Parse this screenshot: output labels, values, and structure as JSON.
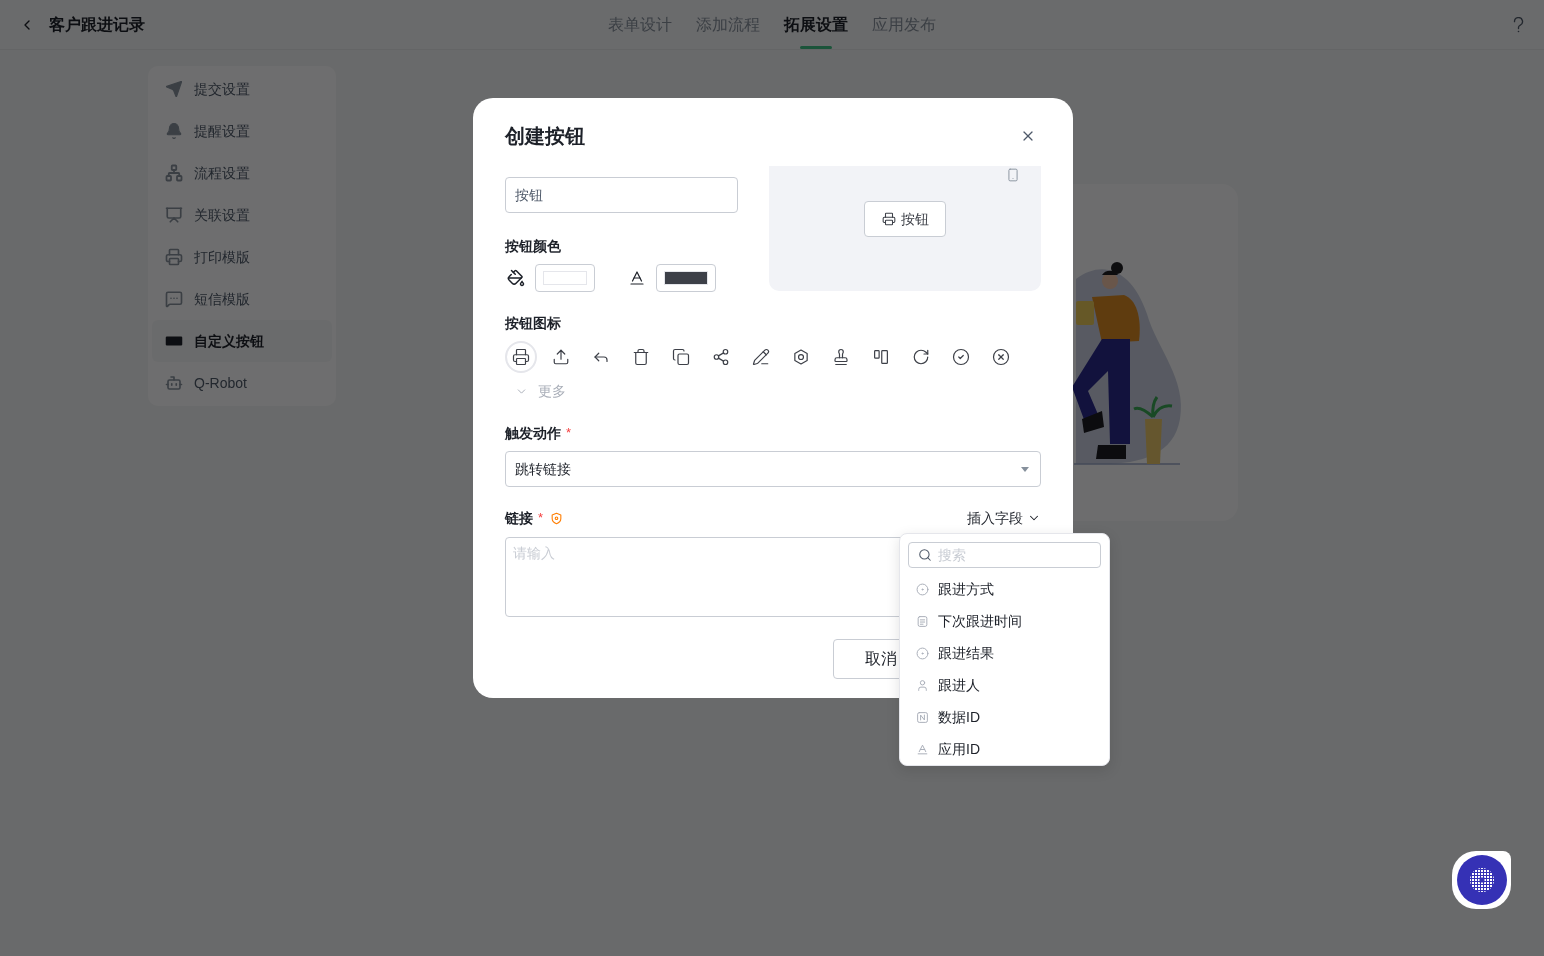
{
  "header": {
    "title": "客户跟进记录",
    "tabs": [
      {
        "label": "表单设计",
        "selected": false
      },
      {
        "label": "添加流程",
        "selected": false
      },
      {
        "label": "拓展设置",
        "selected": true
      },
      {
        "label": "应用发布",
        "selected": false
      }
    ]
  },
  "sidebar": {
    "items": [
      {
        "label": "提交设置",
        "selected": false
      },
      {
        "label": "提醒设置",
        "selected": false
      },
      {
        "label": "流程设置",
        "selected": false
      },
      {
        "label": "关联设置",
        "selected": false
      },
      {
        "label": "打印模版",
        "selected": false
      },
      {
        "label": "短信模版",
        "selected": false
      },
      {
        "label": "自定义按钮",
        "selected": true
      },
      {
        "label": "Q-Robot",
        "selected": false
      }
    ]
  },
  "dialog": {
    "title": "创建按钮",
    "name_input": {
      "value": "按钮"
    },
    "color_section": {
      "label": "按钮颜色",
      "colors": [
        {
          "kind": "fill",
          "color": "#ffffff"
        },
        {
          "kind": "text",
          "color": "#3d4048"
        }
      ]
    },
    "preview": {
      "button_label": "按钮"
    },
    "icon_section": {
      "label": "按钮图标",
      "icons": [
        {
          "selected": true
        },
        {
          "selected": false
        },
        {
          "selected": false
        },
        {
          "selected": false
        },
        {
          "selected": false
        },
        {
          "selected": false
        },
        {
          "selected": false
        },
        {
          "selected": false
        },
        {
          "selected": false
        },
        {
          "selected": false
        },
        {
          "selected": false
        },
        {
          "selected": false
        },
        {
          "selected": false
        }
      ],
      "more": "更多"
    },
    "trigger_action": {
      "label": "触发动作",
      "required_mark": "*",
      "value": "跳转链接"
    },
    "link": {
      "label": "链接",
      "required_mark": "*",
      "insert_field": "插入字段",
      "placeholder": "请输入"
    },
    "buttons": [
      "取消"
    ]
  },
  "insert_field_menu": {
    "search_placeholder": "搜索",
    "items": [
      {
        "label": "跟进方式",
        "kind": "option"
      },
      {
        "label": "下次跟进时间",
        "kind": "date"
      },
      {
        "label": "跟进结果",
        "kind": "option"
      },
      {
        "label": "跟进人",
        "kind": "member"
      },
      {
        "label": "数据ID",
        "kind": "serial"
      },
      {
        "label": "应用ID",
        "kind": "text"
      }
    ]
  }
}
